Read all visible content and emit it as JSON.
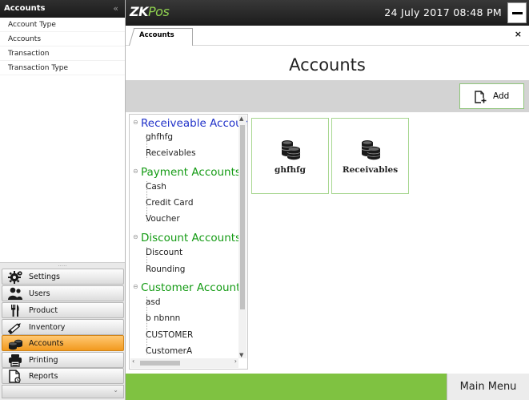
{
  "left_panel": {
    "header": "Accounts",
    "collapse_glyph": "«",
    "sub_items": [
      "Account Type",
      "Accounts",
      "Transaction",
      "Transaction Type"
    ],
    "nav": [
      {
        "label": "Settings",
        "icon": "gear-icon"
      },
      {
        "label": "Users",
        "icon": "users-icon"
      },
      {
        "label": "Product",
        "icon": "cutlery-icon"
      },
      {
        "label": "Inventory",
        "icon": "pencil-icon"
      },
      {
        "label": "Accounts",
        "icon": "coins-icon",
        "active": true
      },
      {
        "label": "Printing",
        "icon": "printer-icon"
      },
      {
        "label": "Reports",
        "icon": "report-icon"
      }
    ]
  },
  "topbar": {
    "logo_zk": "ZK",
    "logo_pos": "Pos",
    "datetime": "24 July 2017 08:48 PM"
  },
  "tabs": {
    "active_tab": "Accounts",
    "close_glyph": "×"
  },
  "page": {
    "title": "Accounts",
    "add_label": "Add"
  },
  "tree": {
    "groups": [
      {
        "label": "Receiveable Accounts",
        "color": "#2132c9",
        "items": [
          "ghfhfg",
          "Receivables"
        ]
      },
      {
        "label": "Payment Accounts",
        "color": "#149b14",
        "items": [
          "Cash",
          "Credit Card",
          "Voucher"
        ]
      },
      {
        "label": "Discount Accounts",
        "color": "#149b14",
        "items": [
          "Discount",
          "Rounding"
        ]
      },
      {
        "label": "Customer Accounts",
        "color": "#149b14",
        "items": [
          "asd",
          "b nbnnn",
          "CUSTOMER",
          "CustomerA"
        ]
      }
    ]
  },
  "tiles": [
    {
      "label": "ghfhfg",
      "icon": "coins-stack-icon"
    },
    {
      "label": "Receivables",
      "icon": "coins-stack-icon"
    }
  ],
  "footer": {
    "main_menu": "Main Menu"
  },
  "colors": {
    "accent_green": "#7fc241",
    "active_orange": "#f29a1f",
    "tile_border": "#a6d68f"
  }
}
